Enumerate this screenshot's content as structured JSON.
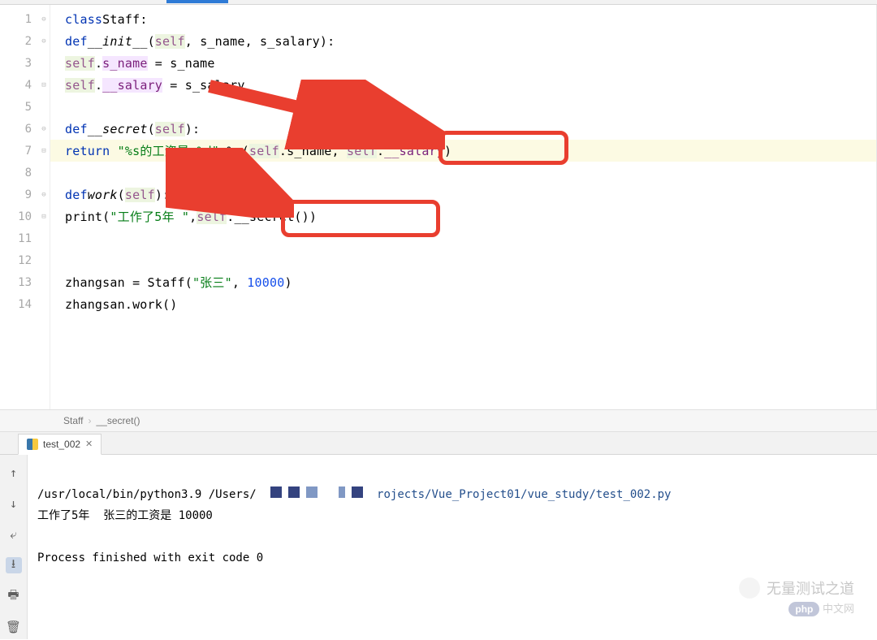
{
  "gutter": {
    "lines": [
      "1",
      "2",
      "3",
      "4",
      "5",
      "6",
      "7",
      "8",
      "9",
      "10",
      "11",
      "12",
      "13",
      "14"
    ]
  },
  "code": {
    "l1": {
      "kw": "class",
      "name": "Staff",
      "colon": ":"
    },
    "l2": {
      "kw": "def",
      "fn": "__init__",
      "open": "(",
      "self": "self",
      "args": ", s_name, s_salary):"
    },
    "l3": {
      "self": "self",
      "dot": ".",
      "attr": "s_name",
      "assign": " = s_name"
    },
    "l4": {
      "self": "self",
      "dot": ".",
      "attr": "__salary",
      "assign": " = s_salary"
    },
    "l6": {
      "kw": "def",
      "fn": "__secret",
      "open": "(",
      "self": "self",
      "close": "):"
    },
    "l7": {
      "kw": "return",
      "pre": " ",
      "str": "\"%s的工资是 %d\"",
      "mid": " % (",
      "self1": "self",
      "a1": ".s_name, ",
      "self2": "self",
      "dot2": ".",
      "attr2": "__salary",
      "end": ")"
    },
    "l9": {
      "kw": "def",
      "fn": "work",
      "open": "(",
      "self": "self",
      "close": "):"
    },
    "l10": {
      "fn": "print",
      "open": "(",
      "str": "\"工作了5年 \"",
      "comma": ",",
      "self": "self",
      "dot": ".",
      "call": "__secret",
      "close": "())"
    },
    "l13": {
      "var": "zhangsan = Staff(",
      "str": "\"张三\"",
      "comma": ", ",
      "num": "10000",
      "close": ")"
    },
    "l14": {
      "line": "zhangsan.work()"
    }
  },
  "breadcrumb": {
    "a": "Staff",
    "b": "__secret()"
  },
  "run_tab": {
    "name": "test_002"
  },
  "console": {
    "cmd_prefix": "/usr/local/bin/python3.9 /Users/",
    "cmd_suffix": "rojects/Vue_Project01/vue_study/test_002.py",
    "out1": "工作了5年  张三的工资是 10000",
    "out2": "Process finished with exit code 0"
  },
  "watermark": {
    "title": "无量测试之道",
    "site": "中文网"
  }
}
